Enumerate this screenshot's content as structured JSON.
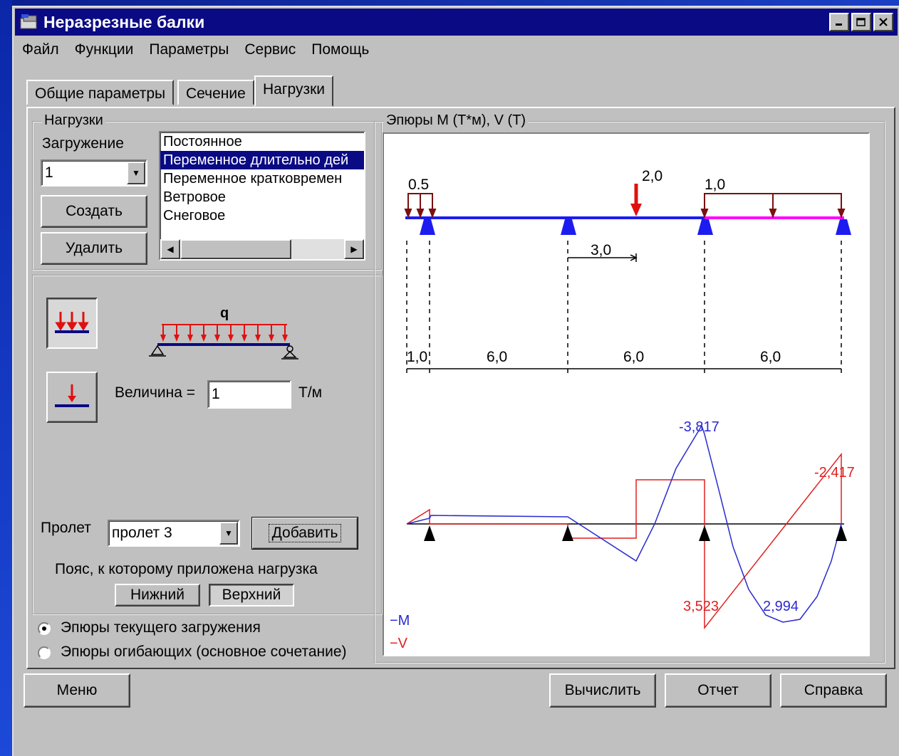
{
  "window": {
    "title": "Неразрезные балки"
  },
  "menu": [
    "Файл",
    "Функции",
    "Параметры",
    "Сервис",
    "Помощь"
  ],
  "tabs": [
    "Общие параметры",
    "Сечение",
    "Нагрузки"
  ],
  "loads_group": {
    "legend": "Нагрузки",
    "loading_label": "Загружение",
    "loading_value": "1",
    "create_label": "Создать",
    "delete_label": "Удалить",
    "load_types": [
      "Постоянное",
      "Переменное длительно дей",
      "Переменное кратковремен",
      "Ветровое",
      "Снеговое"
    ],
    "selected_index": 1
  },
  "load_editor": {
    "q_label": "q",
    "magnitude_label": "Величина =",
    "magnitude_value": "1",
    "unit": "Т/м",
    "span_label": "Пролет",
    "span_value": "пролет 3",
    "add_label": "Добавить",
    "chord_label": "Пояс, к которому приложена нагрузка",
    "lower_label": "Нижний",
    "upper_label": "Верхний"
  },
  "radios": {
    "current": "Эпюры текущего загружения",
    "envelope": "Эпюры огибающих (основное сочетание)"
  },
  "diagram": {
    "legend": "Эпюры    M (Т*м), V (Т)",
    "load_labels": {
      "dist1": "0.5",
      "point": "2,0",
      "dist2": "1,0",
      "offset": "3,0"
    },
    "span_labels": [
      "1,0",
      "6,0",
      "6,0",
      "6,0"
    ],
    "value_labels": {
      "m_min": "-3,817",
      "v_right": "-2,417",
      "v_peak": "3,523",
      "m_peak": "2,994"
    },
    "legend_m": "−M",
    "legend_v": "−V",
    "colors": {
      "beam": "#1c1cf0",
      "beam_loaded": "#ff00ff",
      "moment": "#2a2ad0",
      "shear": "#e02020",
      "load_dist": "#7a1010",
      "support": "#1c1cf0"
    }
  },
  "footer": {
    "menu": "Меню",
    "compute": "Вычислить",
    "report": "Отчет",
    "help": "Справка"
  }
}
